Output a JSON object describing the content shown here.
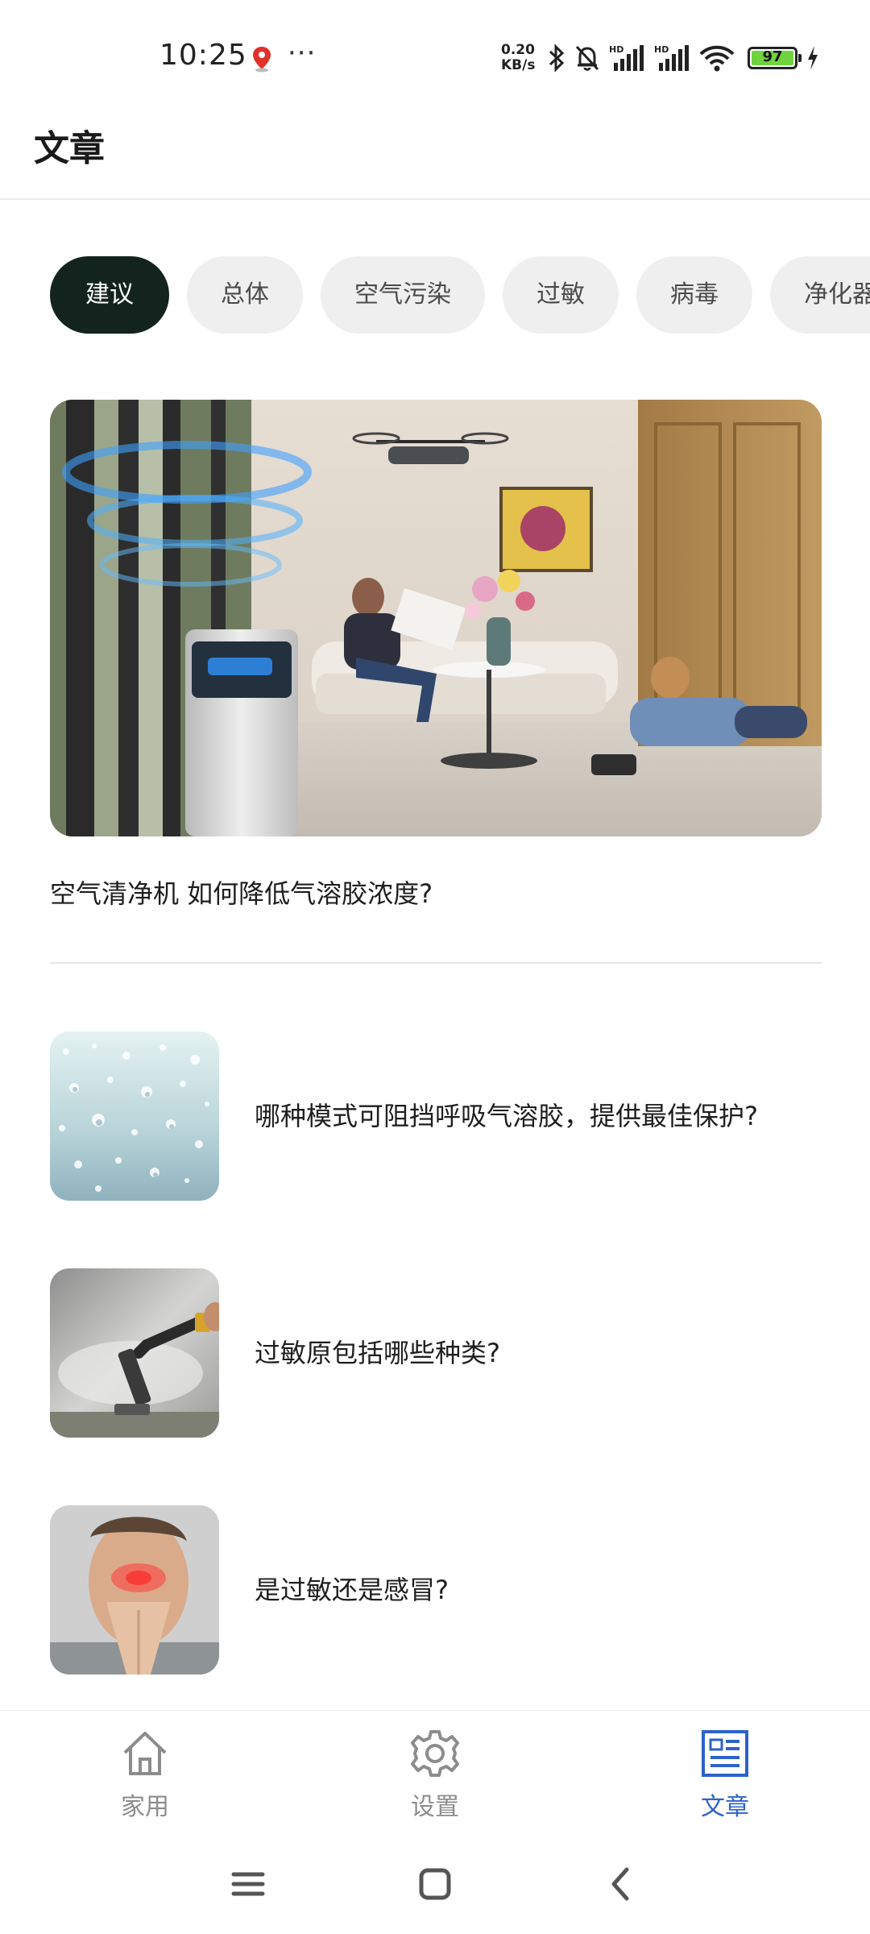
{
  "status_bar": {
    "time": "10:25",
    "more_dots": "···",
    "net_speed_value": "0.20",
    "net_speed_unit": "KB/s",
    "battery": "97",
    "icons": [
      "map-pin-icon",
      "bluetooth-icon",
      "mute-bell-icon",
      "signal-hd-icon",
      "signal-hd-icon",
      "wifi-icon",
      "battery-icon",
      "charging-icon"
    ]
  },
  "header": {
    "title": "文章"
  },
  "chips": [
    "建议",
    "总体",
    "空气污染",
    "过敏",
    "病毒",
    "净化器"
  ],
  "featured": {
    "title": "空气清净机 如何降低气溶胶浓度?"
  },
  "articles": [
    {
      "title": "哪种模式可阻挡呼吸气溶胶，提供最佳保护?"
    },
    {
      "title": "过敏原包括哪些种类?"
    },
    {
      "title": "是过敏还是感冒?"
    }
  ],
  "bottom_nav": {
    "items": [
      {
        "label": "家用",
        "icon": "home-icon"
      },
      {
        "label": "设置",
        "icon": "gear-icon"
      },
      {
        "label": "文章",
        "icon": "article-icon"
      }
    ],
    "active_index": 2,
    "active_color": "#2d63c8",
    "inactive_color": "#8c8c8c"
  },
  "system_nav": {
    "icons": [
      "menu-icon",
      "home-square-icon",
      "back-icon"
    ]
  },
  "colors": {
    "chip_active_bg": "#13241f",
    "chip_bg": "#efefef"
  }
}
